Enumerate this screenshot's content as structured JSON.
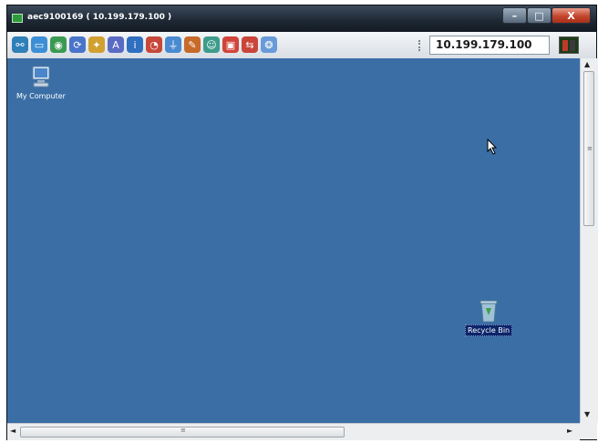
{
  "window": {
    "title": "aec9100169 ( 10.199.179.100 )",
    "buttons": {
      "minimize": "–",
      "maximize": "□",
      "close": "X"
    }
  },
  "toolbar": {
    "icons": [
      {
        "name": "network-icon",
        "color": "#2f7fb8",
        "glyph": "⚯"
      },
      {
        "name": "window-icon",
        "color": "#3c8fd6",
        "glyph": "▭"
      },
      {
        "name": "globe-icon",
        "color": "#3a9a52",
        "glyph": "◉"
      },
      {
        "name": "refresh-icon",
        "color": "#4a74c9",
        "glyph": "⟳"
      },
      {
        "name": "palette-icon",
        "color": "#d0a030",
        "glyph": "✦"
      },
      {
        "name": "text-icon",
        "color": "#5b6bc4",
        "glyph": "A"
      },
      {
        "name": "info-icon",
        "color": "#2f6fc0",
        "glyph": "i"
      },
      {
        "name": "pie-icon",
        "color": "#c7483a",
        "glyph": "◔"
      },
      {
        "name": "filter-icon",
        "color": "#4a8ad0",
        "glyph": "⏚"
      },
      {
        "name": "tools-icon",
        "color": "#c86a2a",
        "glyph": "✎"
      },
      {
        "name": "users-icon",
        "color": "#3f9c8a",
        "glyph": "☺"
      },
      {
        "name": "monitor-red-icon",
        "color": "#d0443a",
        "glyph": "▣"
      },
      {
        "name": "transfer-icon",
        "color": "#c9453a",
        "glyph": "⇆"
      },
      {
        "name": "globe-settings-icon",
        "color": "#6a9ad8",
        "glyph": "❂"
      }
    ],
    "address": "10.199.179.100"
  },
  "desktop": {
    "icons": [
      {
        "name": "my-computer",
        "label": "My Computer",
        "selected": false
      },
      {
        "name": "recycle-bin",
        "label": "Recycle Bin",
        "selected": true
      }
    ]
  },
  "scroll": {
    "up": "▲",
    "down": "▼",
    "left": "◄",
    "right": "►",
    "thumb_grip": "≡"
  },
  "colors": {
    "desktop_bg": "#3a6ea5",
    "titlebar": "#1d2733",
    "close_button": "#c4452c",
    "selection": "#0b246a"
  }
}
